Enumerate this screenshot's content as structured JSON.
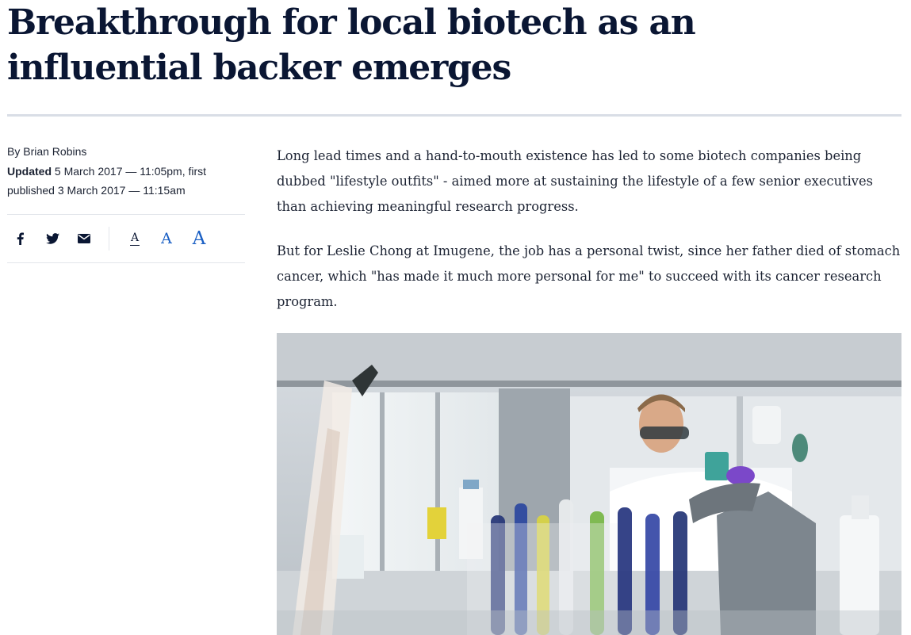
{
  "article": {
    "headline": "Breakthrough for local biotech as an influential backer emerges",
    "byline": "By Brian Robins",
    "updated_label": "Updated",
    "updated_text": " 5 March 2017 — 11:05pm, first published 3 March 2017 — 11:15am",
    "paragraphs": [
      "Long lead times and a hand-to-mouth existence has led to some biotech companies being dubbed \"lifestyle outfits\" - aimed more at sustaining the lifestyle of a few senior executives than achieving meaningful research progress.",
      "But for Leslie Chong at Imugene, the job has a personal twist, since her father died of stomach cancer, which \"has made it much more personal for me\" to succeed with its cancer research program."
    ]
  },
  "tools": {
    "share_icons": [
      "facebook-icon",
      "twitter-icon",
      "email-icon"
    ],
    "font_size_labels": [
      "A",
      "A",
      "A"
    ]
  },
  "colors": {
    "headline": "#0a1633",
    "accent_blue": "#1a5fc4",
    "rule": "#d9dee6"
  }
}
